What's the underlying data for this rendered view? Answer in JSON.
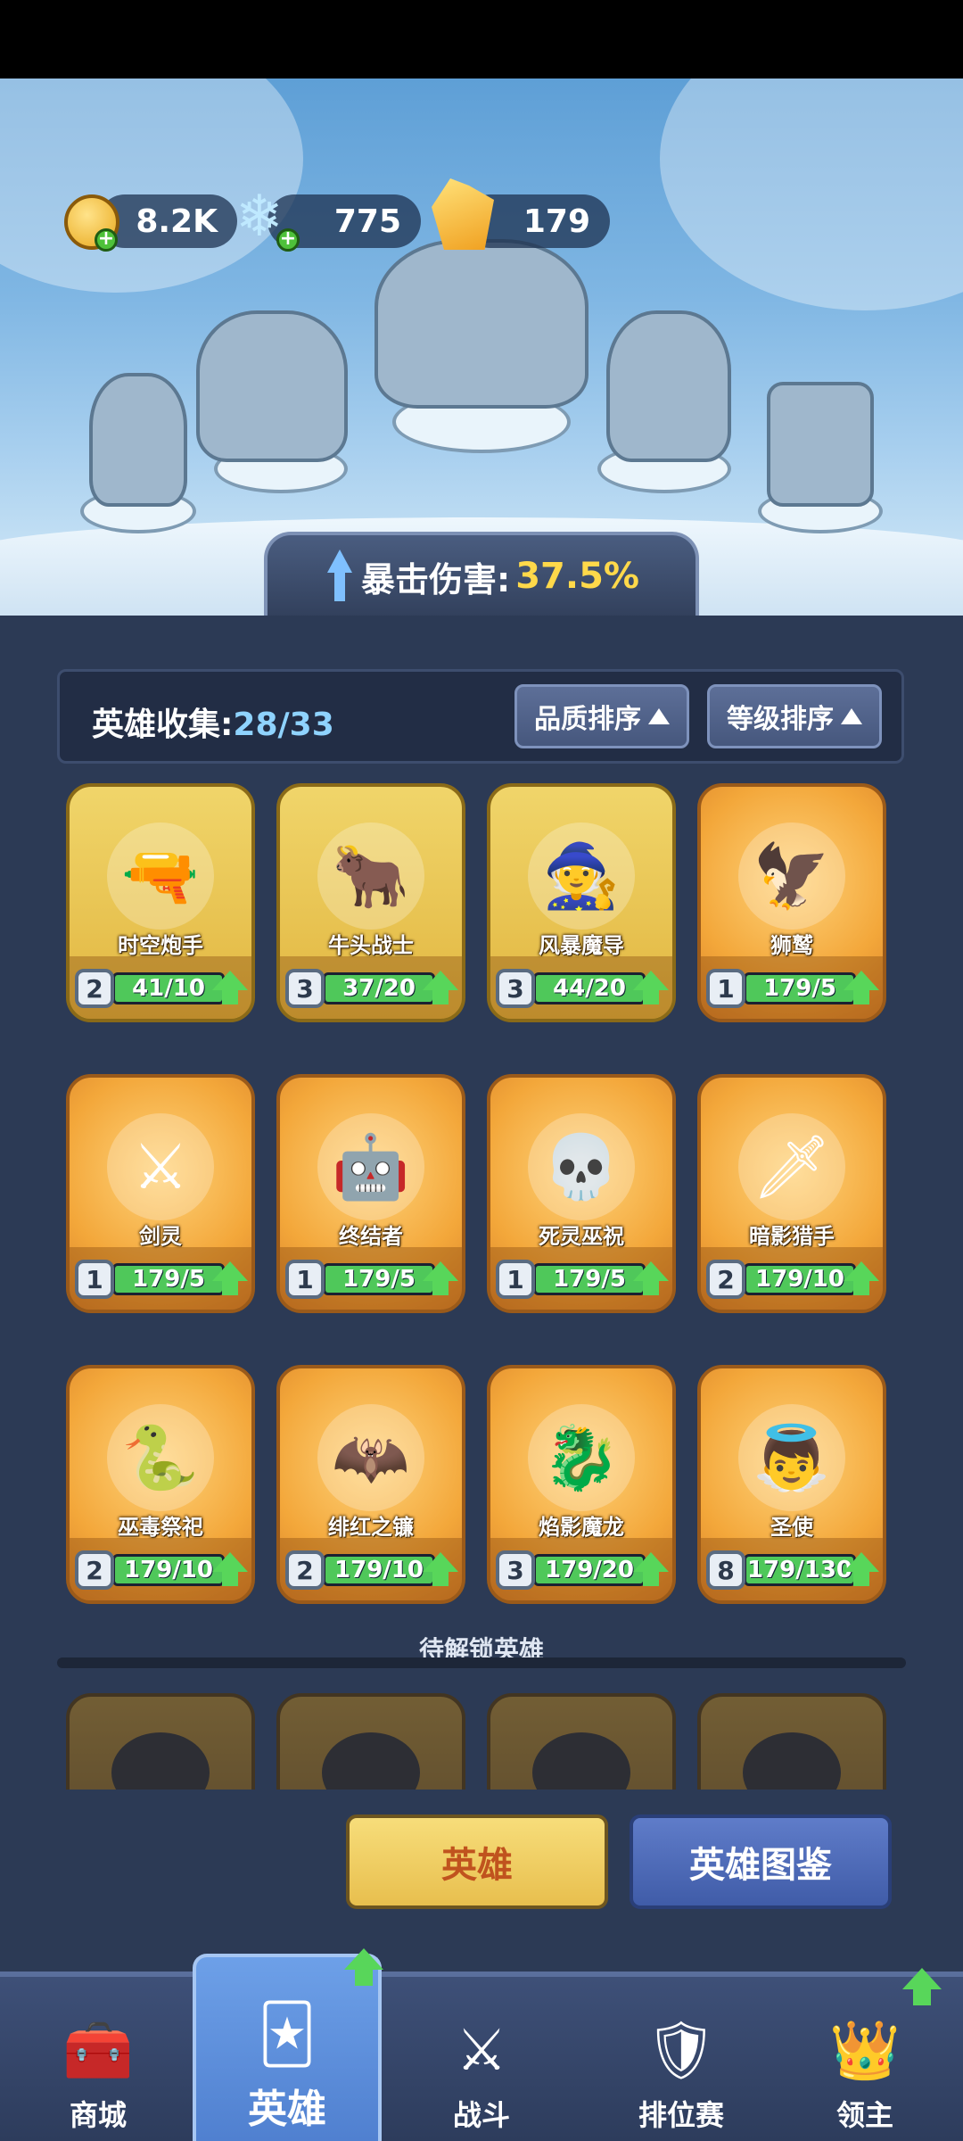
{
  "resources": {
    "gold": {
      "icon": "gold-coin-icon",
      "value": "8.2K"
    },
    "gems": {
      "icon": "ice-crystal-icon",
      "value": "775"
    },
    "crystals": {
      "icon": "amber-crystal-icon",
      "value": "179"
    }
  },
  "banner": {
    "label": "暴击伤害:",
    "value": "37.5%"
  },
  "collection": {
    "label": "英雄收集:",
    "count": "28/33",
    "sort_quality": "品质排序",
    "sort_level": "等级排序"
  },
  "heroes": [
    {
      "name": "时空炮手",
      "level": "2",
      "progress": "41/10",
      "fill": 1.0,
      "style": "gold",
      "icon": "gunner-icon"
    },
    {
      "name": "牛头战士",
      "level": "3",
      "progress": "37/20",
      "fill": 1.0,
      "style": "gold",
      "icon": "minotaur-icon"
    },
    {
      "name": "风暴魔导",
      "level": "3",
      "progress": "44/20",
      "fill": 1.0,
      "style": "gold",
      "icon": "wizard-icon"
    },
    {
      "name": "狮鹫",
      "level": "1",
      "progress": "179/5",
      "fill": 1.0,
      "style": "orange",
      "icon": "griffin-icon"
    },
    {
      "name": "剑灵",
      "level": "1",
      "progress": "179/5",
      "fill": 1.0,
      "style": "orange",
      "icon": "sword-spirit-icon"
    },
    {
      "name": "终结者",
      "level": "1",
      "progress": "179/5",
      "fill": 1.0,
      "style": "orange",
      "icon": "terminator-icon"
    },
    {
      "name": "死灵巫祝",
      "level": "1",
      "progress": "179/5",
      "fill": 1.0,
      "style": "orange",
      "icon": "necromancer-icon"
    },
    {
      "name": "暗影猎手",
      "level": "2",
      "progress": "179/10",
      "fill": 1.0,
      "style": "orange",
      "icon": "shadow-hunter-icon"
    },
    {
      "name": "巫毒祭祀",
      "level": "2",
      "progress": "179/10",
      "fill": 1.0,
      "style": "orange",
      "icon": "voodoo-priest-icon"
    },
    {
      "name": "绯红之镰",
      "level": "2",
      "progress": "179/10",
      "fill": 1.0,
      "style": "orange",
      "icon": "crimson-scythe-icon"
    },
    {
      "name": "焰影魔龙",
      "level": "3",
      "progress": "179/20",
      "fill": 1.0,
      "style": "orange",
      "icon": "dragon-icon"
    },
    {
      "name": "圣使",
      "level": "8",
      "progress": "179/130",
      "fill": 1.0,
      "style": "orange",
      "icon": "angel-icon"
    }
  ],
  "locked_section": {
    "title": "待解锁英雄"
  },
  "buttons": {
    "heroes": "英雄",
    "codex": "英雄图鉴"
  },
  "nav": [
    {
      "label": "商城",
      "icon": "shop-chest-icon",
      "active": false,
      "badge": false
    },
    {
      "label": "英雄",
      "icon": "hero-card-icon",
      "active": true,
      "badge": true
    },
    {
      "label": "战斗",
      "icon": "crossed-swords-icon",
      "active": false,
      "badge": false
    },
    {
      "label": "排位赛",
      "icon": "ranked-shield-icon",
      "active": false,
      "badge": false
    },
    {
      "label": "领主",
      "icon": "lord-banner-icon",
      "active": false,
      "badge": true
    }
  ],
  "colors": {
    "panel": "#2c3a55",
    "accent_gold": "#ffd94a",
    "accent_blue": "#8fd3ff",
    "progress_green": "#4fc85a"
  }
}
